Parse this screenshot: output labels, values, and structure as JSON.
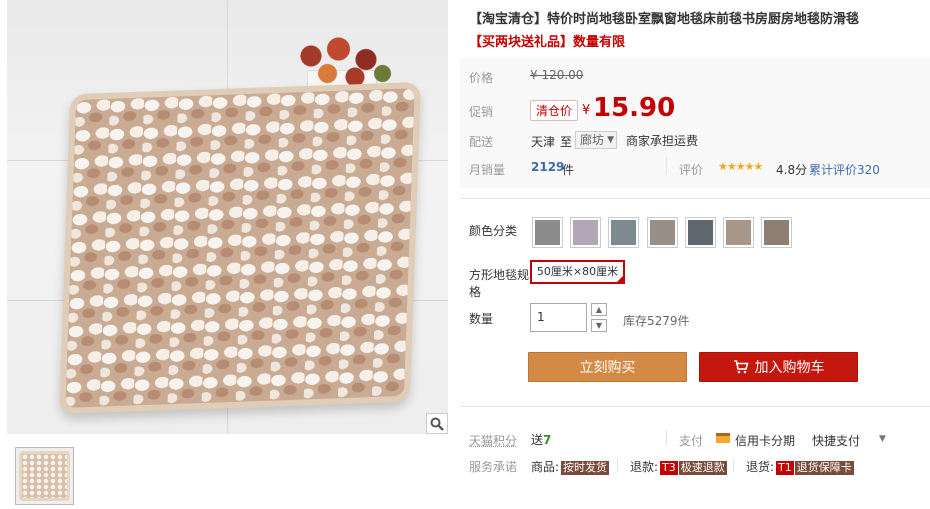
{
  "title": "【淘宝清仓】特价时尚地毯卧室飘窗地毯床前毯书房厨房地毯防滑毯",
  "subtitle": "【买两块送礼品】数量有限",
  "price": {
    "label": "价格",
    "original": "¥ 120.00",
    "promo_label": "促销",
    "promo_badge": "清仓价",
    "currency": "¥",
    "promo_price": "15.90"
  },
  "shipping": {
    "label": "配送",
    "from": "天津",
    "to_word": "至",
    "city": "廊坊",
    "note": "商家承担运费"
  },
  "sales": {
    "label": "月销量",
    "count": "2129",
    "unit": "件",
    "rating_label": "评价",
    "stars": "★★★★★",
    "score": "4.8分",
    "reviews": "累计评价320"
  },
  "options": {
    "color_label": "颜色分类",
    "swatches": [
      {
        "color": "#8c8c8c"
      },
      {
        "color": "#b3a6b8"
      },
      {
        "color": "#7d8b90"
      },
      {
        "color": "#9a8f86"
      },
      {
        "color": "#5f6870"
      },
      {
        "color": "#a89788"
      },
      {
        "color": "#8f7e72"
      }
    ],
    "size_label_line1": "方形地毯规",
    "size_label_line2": "格",
    "size_value": "50厘米×80厘米",
    "qty_label": "数量",
    "qty_value": "1",
    "stock": "库存5279件"
  },
  "buttons": {
    "buy": "立刻购买",
    "cart": "加入购物车"
  },
  "footer": {
    "points_label": "天猫积分",
    "points_prefix": "送",
    "points_value": "7",
    "pay_label": "支付",
    "credit": "信用卡分期",
    "quick_pay": "快捷支付",
    "service_label": "服务承诺",
    "goods_label": "商品:",
    "goods_badge": "按时发货",
    "refund_label": "退款:",
    "refund_t": "T3",
    "refund_badge": "极速退款",
    "return_label": "退货:",
    "return_t": "T1",
    "return_badge": "退货保障卡"
  },
  "icons": {
    "zoom": "magnifier-icon",
    "cart": "shopping-cart-icon",
    "card": "credit-card-icon"
  }
}
